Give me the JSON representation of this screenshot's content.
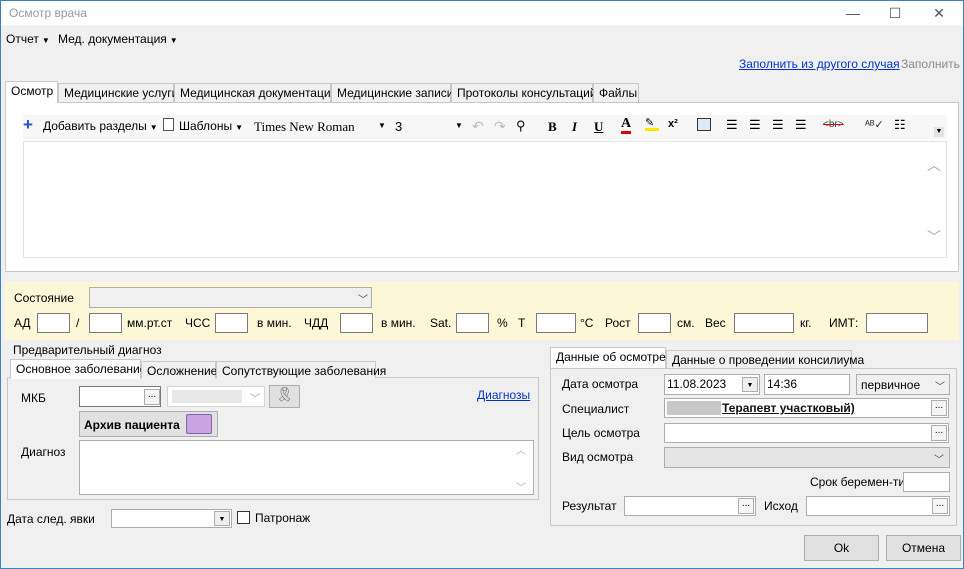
{
  "window": {
    "title": "Осмотр врача",
    "minimize": "—",
    "maximize": "☐",
    "close": "✕"
  },
  "menu": {
    "items": [
      "Отчет",
      "Мед. документация"
    ]
  },
  "links": {
    "fill_from_other": "Заполнить из другого случая",
    "fill": "Заполнить"
  },
  "tabs": [
    "Осмотр",
    "Медицинские услуги",
    "Медицинская документация",
    "Медицинские записи",
    "Протоколы консультаций",
    "Файлы"
  ],
  "toolbar": {
    "add_sections": "Добавить разделы",
    "templates": "Шаблоны",
    "font": "Times New Roman",
    "font_size": "3"
  },
  "vitals": {
    "state_label": "Состояние",
    "ad_label": "АД",
    "slash": "/",
    "mmhg": "мм.рт.ст",
    "chss_label": "ЧСС",
    "per_min1": "в мин.",
    "chdd_label": "ЧДД",
    "per_min2": "в мин.",
    "sat_label": "Sat.",
    "percent": "%",
    "t_label": "Т",
    "celsius": "°С",
    "height_label": "Рост",
    "cm": "см.",
    "weight_label": "Вес",
    "kg": "кг.",
    "bmi_label": "ИМТ:"
  },
  "diagnosis": {
    "group_title": "Предварительный диагноз",
    "tabs": [
      "Основное заболевание",
      "Осложнение",
      "Сопутствующие заболевания"
    ],
    "mkb_label": "МКБ",
    "diagnoses_link": "Диагнозы",
    "archive_button": "Архив пациента",
    "diagnosis_label": "Диагноз"
  },
  "next_visit": {
    "label": "Дата след. явки",
    "patronage": "Патронаж"
  },
  "exam": {
    "tabs": [
      "Данные об осмотре",
      "Данные о проведении консилиума"
    ],
    "date_label": "Дата осмотра",
    "date": "11.08.2023",
    "time": "14:36",
    "type_value": "первичное",
    "specialist_label": "Специалист",
    "specialist": "Терапевт участковый)",
    "purpose_label": "Цель осмотра",
    "kind_label": "Вид осмотра",
    "pregnancy_label": "Срок беремен-ти",
    "result_label": "Результат",
    "outcome_label": "Исход"
  },
  "buttons": {
    "ok": "Ok",
    "cancel": "Отмена"
  }
}
